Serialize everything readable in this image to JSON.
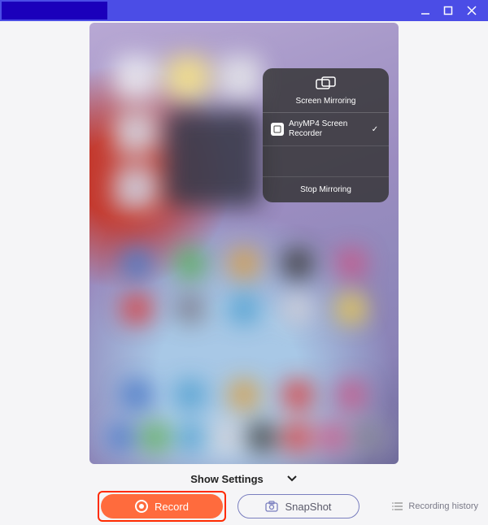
{
  "colors": {
    "accent": "#4b4de6",
    "record": "#ff6b3d",
    "record_outline": "#ff2a00"
  },
  "mirror_panel": {
    "title": "Screen Mirroring",
    "device_name": "AnyMP4 Screen Recorder",
    "stop_label": "Stop Mirroring"
  },
  "bottom": {
    "show_settings": "Show Settings",
    "record_label": "Record",
    "snapshot_label": "SnapShot",
    "history_label": "Recording history"
  }
}
